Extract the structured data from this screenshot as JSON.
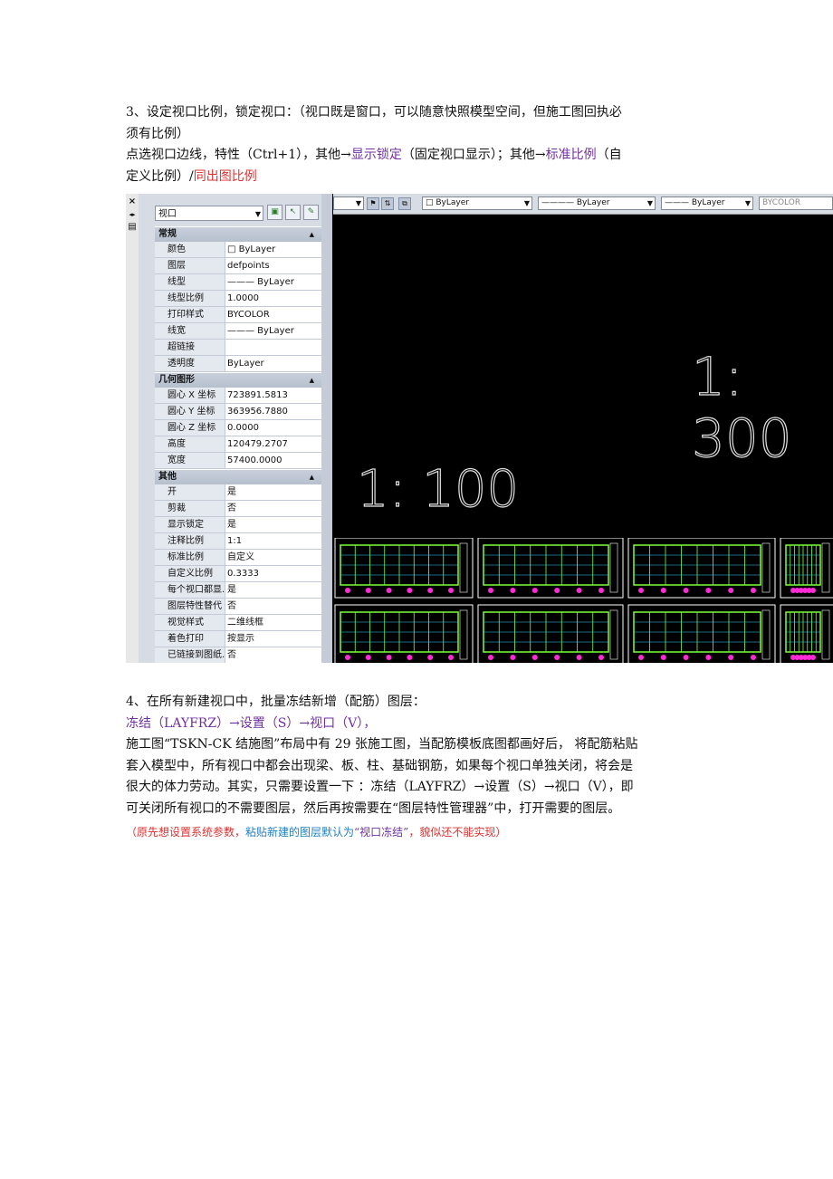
{
  "section3": {
    "line1": "3、设定视口比例，锁定视口：（视口既是窗口，可以随意快照模型空间，但施工图回执必",
    "line2": "须有比例）",
    "line3_a": "点选视口边线，特性（Ctrl+1），其他→",
    "line3_b": "显示锁定",
    "line3_c": "（固定视口显示）；其他→",
    "line3_d": "标准比例",
    "line3_e": "（自",
    "line4_a": "定义比例）/",
    "line4_b": "同出图比例"
  },
  "screenshot": {
    "leftbar": {
      "close": "×",
      "arrows": "◂▸",
      "icon": "▤"
    },
    "panel": {
      "object_type": "视口",
      "sections": [
        {
          "title": "常规",
          "rows": [
            {
              "k": "颜色",
              "v": "□ ByLayer"
            },
            {
              "k": "图层",
              "v": "defpoints"
            },
            {
              "k": "线型",
              "v": "——— ByLayer"
            },
            {
              "k": "线型比例",
              "v": "1.0000"
            },
            {
              "k": "打印样式",
              "v": "BYCOLOR"
            },
            {
              "k": "线宽",
              "v": "——— ByLayer"
            },
            {
              "k": "超链接",
              "v": ""
            },
            {
              "k": "透明度",
              "v": "ByLayer"
            }
          ]
        },
        {
          "title": "几何图形",
          "rows": [
            {
              "k": "圆心 X 坐标",
              "v": "723891.5813"
            },
            {
              "k": "圆心 Y 坐标",
              "v": "363956.7880"
            },
            {
              "k": "圆心 Z 坐标",
              "v": "0.0000"
            },
            {
              "k": "高度",
              "v": "120479.2707"
            },
            {
              "k": "宽度",
              "v": "57400.0000"
            }
          ]
        },
        {
          "title": "其他",
          "rows": [
            {
              "k": "开",
              "v": "是"
            },
            {
              "k": "剪裁",
              "v": "否"
            },
            {
              "k": "显示锁定",
              "v": "是"
            },
            {
              "k": "注释比例",
              "v": "1:1"
            },
            {
              "k": "标准比例",
              "v": "自定义"
            },
            {
              "k": "自定义比例",
              "v": "0.3333"
            },
            {
              "k": "每个视口都显...",
              "v": "是"
            },
            {
              "k": "图层特性替代",
              "v": "否"
            },
            {
              "k": "视觉样式",
              "v": "二维线框"
            },
            {
              "k": "着色打印",
              "v": "按显示"
            },
            {
              "k": "已链接到图纸...",
              "v": "否"
            }
          ]
        }
      ]
    },
    "toolbar": {
      "color": "□ ByLayer",
      "linetype": "———— ByLayer",
      "lineweight": "——— ByLayer",
      "plotstyle": "BYCOLOR"
    },
    "scale_large": "1: 300",
    "scale_small": "1: 100",
    "colors": {
      "grid_green": "#7cff3c",
      "beam_magenta": "#ff2bd6",
      "frame_white": "#ffffff",
      "axis_cyan": "#37d4ff"
    }
  },
  "section4": {
    "line1": "4、在所有新建视口中，批量冻结新增（配筋）图层：",
    "line2": "冻结（LAYFRZ）→设置（S）→视口（V），",
    "line3": "施工图“TSKN-CK 结施图”布局中有 29 张施工图，当配筋模板底图都画好后， 将配筋粘贴",
    "line4": "套入模型中，所有视口中都会出现梁、板、柱、基础钢筋，如果每个视口单独关闭，将会是",
    "line5": "很大的体力劳动。其实，只需要设置一下 ：冻结（LAYFRZ）→设置（S）→视口（V），即",
    "line6": "可关闭所有视口的不需要图层，然后再按需要在“图层特性管理器”中，打开需要的图层。",
    "note_a": "（原先想设置系统参数，",
    "note_b": "粘贴新建的图层默认为",
    "note_c": "“视口冻结”",
    "note_d": "，貌似还不能实现）"
  }
}
